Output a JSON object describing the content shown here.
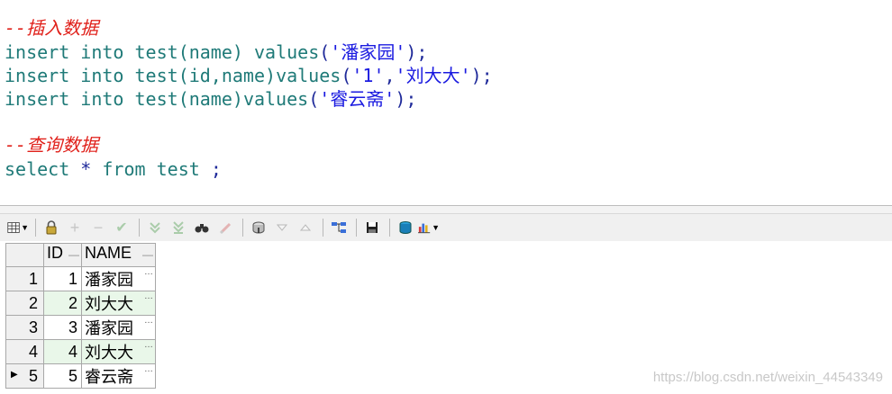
{
  "editor": {
    "comment_insert": "--插入数据",
    "line1": {
      "insert": "insert",
      "into": "into",
      "table": "test",
      "cols": "(name)",
      "values": "values",
      "open": "(",
      "str1": "'潘家园'",
      "close": ");"
    },
    "line2": {
      "insert": "insert",
      "into": "into",
      "table": "test",
      "cols": "(id,name)",
      "values": "values",
      "open": "(",
      "str1": "'1'",
      "comma": ",",
      "str2": "'刘大大'",
      "close": ");"
    },
    "line3": {
      "insert": "insert",
      "into": "into",
      "table": "test",
      "cols": "(name)",
      "values": "values",
      "open": "(",
      "str1": "'睿云斋'",
      "close": ");"
    },
    "comment_query": "--查询数据",
    "line4": {
      "select": "select",
      "star": "*",
      "from": "from",
      "table": "test",
      "semi": ";"
    }
  },
  "toolbar": {
    "icons": [
      "grid-options-icon",
      "lock-icon",
      "plus-icon",
      "minus-icon",
      "check-icon",
      "next-page-icon",
      "last-page-icon",
      "find-icon",
      "clear-icon",
      "fetch-icon",
      "move-down-icon",
      "move-up-icon",
      "query-tree-icon",
      "save-icon",
      "export-icon",
      "chart-icon"
    ]
  },
  "grid": {
    "columns": [
      "ID",
      "NAME"
    ],
    "rows": [
      {
        "num": "1",
        "id": "1",
        "name": "潘家园"
      },
      {
        "num": "2",
        "id": "2",
        "name": "刘大大"
      },
      {
        "num": "3",
        "id": "3",
        "name": "潘家园"
      },
      {
        "num": "4",
        "id": "4",
        "name": "刘大大"
      },
      {
        "num": "5",
        "id": "5",
        "name": "睿云斋"
      }
    ],
    "more_glyph": "…"
  },
  "watermark": "https://blog.csdn.net/weixin_44543349",
  "colors": {
    "comment": "#e0201a",
    "keyword": "#1f7a78",
    "string": "#1a1ae0",
    "alt_row": "#e9f7e9"
  }
}
